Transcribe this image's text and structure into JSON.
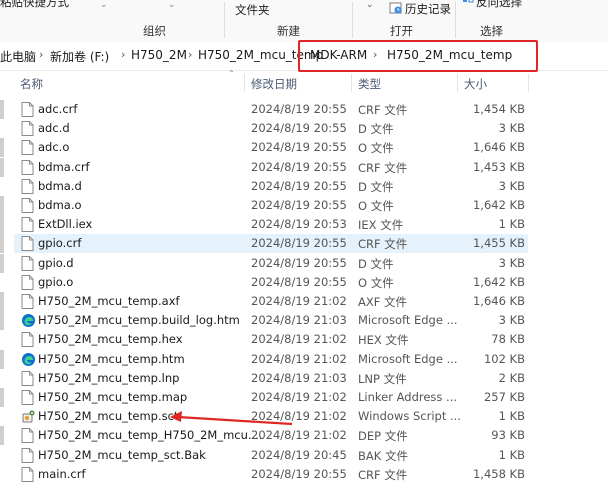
{
  "ribbon": {
    "truncated_item": "粘贴快捷方式",
    "group_organize": "组织",
    "folder_label": "文件夹",
    "group_new": "新建",
    "history_label": "历史记录",
    "group_open": "打开",
    "invert_select_label": "反向选择",
    "group_select": "选择"
  },
  "address": {
    "crumbs": [
      "此电脑",
      "新加卷 (F:)",
      "H750_2M",
      "H750_2M_mcu_temp",
      "MDK-ARM",
      "H750_2M_mcu_temp"
    ]
  },
  "columns": {
    "name": "名称",
    "date": "修改日期",
    "type": "类型",
    "size": "大小"
  },
  "accent": {
    "highlight_red": "#e02525",
    "selection": "#e5f1fb",
    "edge_blue": "#0c6fd1"
  },
  "files": [
    {
      "name": "adc.crf",
      "date": "2024/8/19 20:55",
      "type": "CRF 文件",
      "size": "1,454 KB",
      "icon": "file-icon"
    },
    {
      "name": "adc.d",
      "date": "2024/8/19 20:55",
      "type": "D 文件",
      "size": "3 KB",
      "icon": "file-icon"
    },
    {
      "name": "adc.o",
      "date": "2024/8/19 20:55",
      "type": "O 文件",
      "size": "1,646 KB",
      "icon": "file-icon"
    },
    {
      "name": "bdma.crf",
      "date": "2024/8/19 20:55",
      "type": "CRF 文件",
      "size": "1,453 KB",
      "icon": "file-icon"
    },
    {
      "name": "bdma.d",
      "date": "2024/8/19 20:55",
      "type": "D 文件",
      "size": "3 KB",
      "icon": "file-icon"
    },
    {
      "name": "bdma.o",
      "date": "2024/8/19 20:55",
      "type": "O 文件",
      "size": "1,642 KB",
      "icon": "file-icon"
    },
    {
      "name": "ExtDll.iex",
      "date": "2024/8/19 20:53",
      "type": "IEX 文件",
      "size": "1 KB",
      "icon": "file-icon"
    },
    {
      "name": "gpio.crf",
      "date": "2024/8/19 20:55",
      "type": "CRF 文件",
      "size": "1,455 KB",
      "icon": "file-icon",
      "selected": true
    },
    {
      "name": "gpio.d",
      "date": "2024/8/19 20:55",
      "type": "D 文件",
      "size": "3 KB",
      "icon": "file-icon"
    },
    {
      "name": "gpio.o",
      "date": "2024/8/19 20:55",
      "type": "O 文件",
      "size": "1,642 KB",
      "icon": "file-icon"
    },
    {
      "name": "H750_2M_mcu_temp.axf",
      "date": "2024/8/19 21:02",
      "type": "AXF 文件",
      "size": "1,646 KB",
      "icon": "file-icon"
    },
    {
      "name": "H750_2M_mcu_temp.build_log.htm",
      "date": "2024/8/19 21:03",
      "type": "Microsoft Edge ...",
      "size": "3 KB",
      "icon": "edge-icon"
    },
    {
      "name": "H750_2M_mcu_temp.hex",
      "date": "2024/8/19 21:02",
      "type": "HEX 文件",
      "size": "78 KB",
      "icon": "file-icon"
    },
    {
      "name": "H750_2M_mcu_temp.htm",
      "date": "2024/8/19 21:02",
      "type": "Microsoft Edge ...",
      "size": "102 KB",
      "icon": "edge-icon"
    },
    {
      "name": "H750_2M_mcu_temp.lnp",
      "date": "2024/8/19 21:03",
      "type": "LNP 文件",
      "size": "2 KB",
      "icon": "file-icon"
    },
    {
      "name": "H750_2M_mcu_temp.map",
      "date": "2024/8/19 21:02",
      "type": "Linker Address ...",
      "size": "257 KB",
      "icon": "file-icon"
    },
    {
      "name": "H750_2M_mcu_temp.sct",
      "date": "2024/8/19 21:02",
      "type": "Windows Script ...",
      "size": "1 KB",
      "icon": "script-icon"
    },
    {
      "name": "H750_2M_mcu_temp_H750_2M_mcu....",
      "date": "2024/8/19 21:02",
      "type": "DEP 文件",
      "size": "93 KB",
      "icon": "file-icon"
    },
    {
      "name": "H750_2M_mcu_temp_sct.Bak",
      "date": "2024/8/19 20:45",
      "type": "BAK 文件",
      "size": "1 KB",
      "icon": "file-icon"
    },
    {
      "name": "main.crf",
      "date": "2024/8/19 20:55",
      "type": "CRF 文件",
      "size": "1,458 KB",
      "icon": "file-icon"
    }
  ]
}
